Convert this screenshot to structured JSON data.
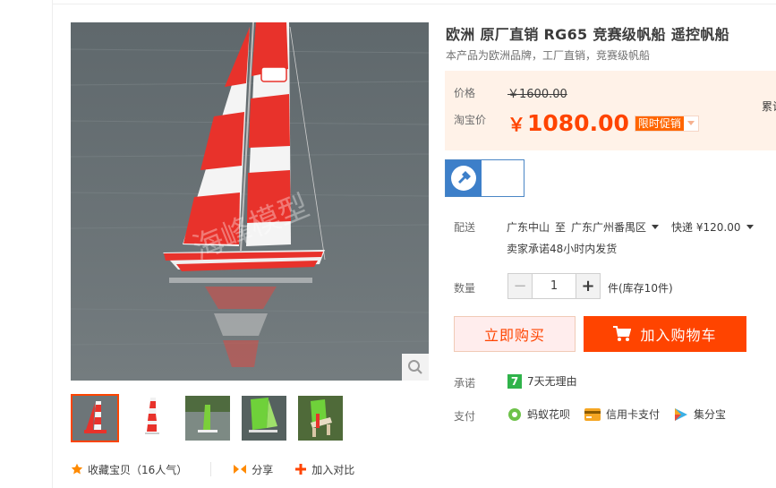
{
  "product": {
    "title": "欧洲 原厂直销 RG65 竞赛级帆船 遥控帆船",
    "subtitle": "本产品为欧洲品牌，工厂直销，竞赛级帆船",
    "watermark": "海峰模型"
  },
  "price": {
    "label": "价格",
    "original": "￥1600.00",
    "tb_label": "淘宝价",
    "currency": "￥",
    "amount": "1080.00",
    "promo_tag": "限时促销",
    "side_note": "累计"
  },
  "shipping": {
    "label": "配送",
    "from": "广东中山",
    "to_word": "至",
    "to": "广东广州番禺区",
    "method": "快递 ¥120.00",
    "promise": "卖家承诺48小时内发货"
  },
  "quantity": {
    "label": "数量",
    "value": "1",
    "minus": "−",
    "plus": "+",
    "stock": "件(库存10件)"
  },
  "buttons": {
    "buy_now": "立即购买",
    "add_cart": "加入购物车"
  },
  "promise": {
    "label": "承诺",
    "badge": "7",
    "text": "7天无理由"
  },
  "payment": {
    "label": "支付",
    "methods": [
      "蚂蚁花呗",
      "信用卡支付",
      "集分宝"
    ]
  },
  "actions": {
    "favorite": "收藏宝贝（16人气）",
    "share": "分享",
    "compare": "加入对比"
  },
  "colors": {
    "accent": "#ff4400",
    "price_bg": "#fff2e8",
    "sail_red": "#e8322b"
  }
}
